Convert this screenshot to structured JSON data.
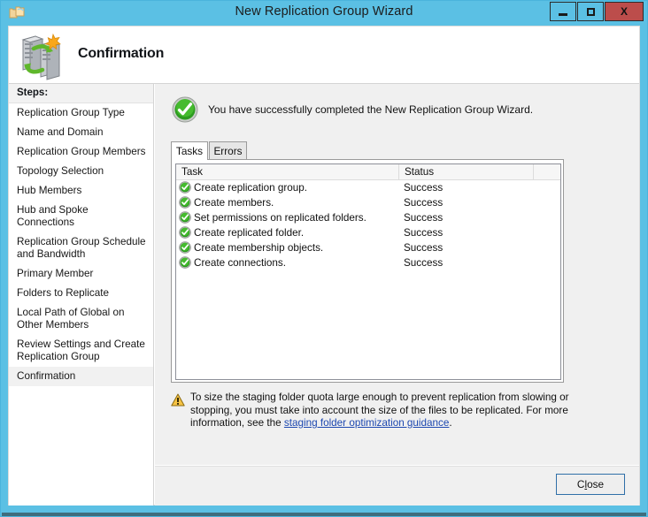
{
  "window": {
    "title": "New Replication Group Wizard",
    "icon": "folder-replication-icon",
    "frame_color": "#5bc0e4",
    "controls": {
      "minimize_label": "Minimize",
      "maximize_label": "Maximize",
      "close_label": "X"
    }
  },
  "banner": {
    "title": "Confirmation",
    "icon": "replication-servers-icon"
  },
  "sidebar": {
    "header": "Steps:",
    "items": [
      {
        "label": "Replication Group Type",
        "active": false
      },
      {
        "label": "Name and Domain",
        "active": false
      },
      {
        "label": "Replication Group Members",
        "active": false
      },
      {
        "label": "Topology Selection",
        "active": false
      },
      {
        "label": "Hub Members",
        "active": false
      },
      {
        "label": "Hub and Spoke Connections",
        "active": false
      },
      {
        "label": "Replication Group Schedule and Bandwidth",
        "active": false
      },
      {
        "label": "Primary Member",
        "active": false
      },
      {
        "label": "Folders to Replicate",
        "active": false
      },
      {
        "label": "Local Path of Global on Other Members",
        "active": false
      },
      {
        "label": "Review Settings and Create Replication Group",
        "active": false
      },
      {
        "label": "Confirmation",
        "active": true
      }
    ]
  },
  "main": {
    "success_message": "You have successfully completed the New Replication Group Wizard.",
    "success_icon": "green-check-circle-icon",
    "tabs": [
      {
        "label": "Tasks",
        "active": true
      },
      {
        "label": "Errors",
        "active": false
      }
    ],
    "list": {
      "columns": [
        "Task",
        "Status",
        ""
      ],
      "rows": [
        {
          "icon": "green-check-icon",
          "task": "Create replication group.",
          "status": "Success"
        },
        {
          "icon": "green-check-icon",
          "task": "Create members.",
          "status": "Success"
        },
        {
          "icon": "green-check-icon",
          "task": "Set permissions on replicated folders.",
          "status": "Success"
        },
        {
          "icon": "green-check-icon",
          "task": "Create replicated folder.",
          "status": "Success"
        },
        {
          "icon": "green-check-icon",
          "task": "Create membership objects.",
          "status": "Success"
        },
        {
          "icon": "green-check-icon",
          "task": "Create connections.",
          "status": "Success"
        }
      ]
    },
    "note": {
      "icon": "warning-triangle-icon",
      "text_before": "To size the staging folder quota large enough to prevent replication from slowing or stopping, you must take into account the size of the files to be replicated. For more information, see the ",
      "link_text": "staging folder optimization guidance",
      "text_after": ".",
      "link_color": "#1d48b0"
    }
  },
  "footer": {
    "close_label_prefix": "C",
    "close_label_accel": "l",
    "close_label_suffix": "ose"
  }
}
